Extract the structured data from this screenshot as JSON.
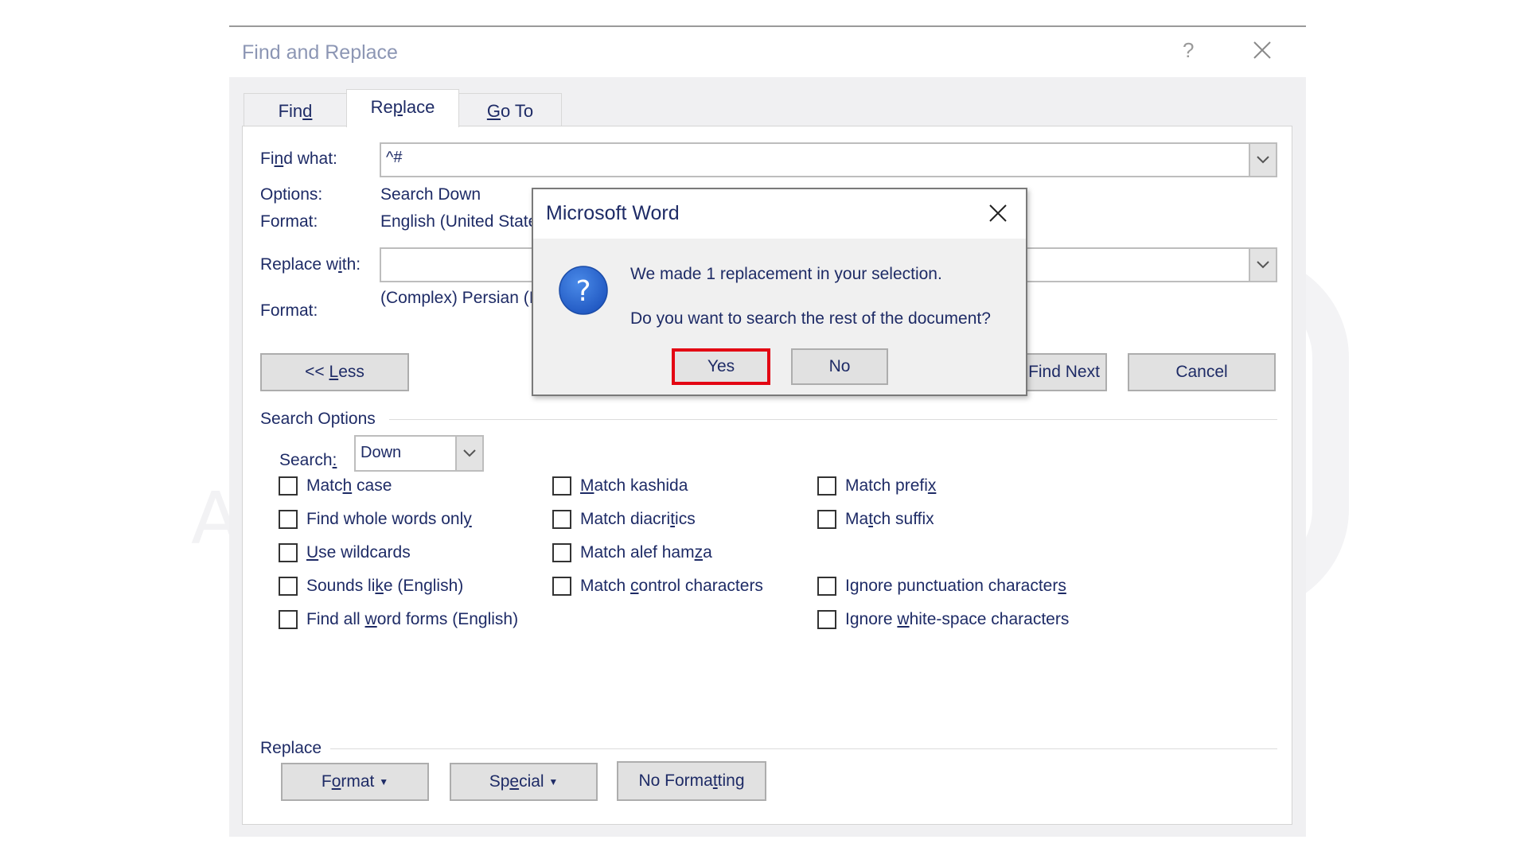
{
  "dialog": {
    "title": "Find and Replace",
    "help_label": "?",
    "close_icon": "close-icon",
    "tabs": [
      {
        "label": "Find",
        "accel": "d",
        "active": false
      },
      {
        "label": "Replace",
        "accel": "p",
        "active": true
      },
      {
        "label": "Go To",
        "accel": "G",
        "active": false
      }
    ],
    "find_what": {
      "label": "Find what:",
      "value": "^#"
    },
    "options": {
      "label": "Options:",
      "value": "Search Down"
    },
    "find_format": {
      "label": "Format:",
      "value": "English (United States)"
    },
    "replace_with": {
      "label": "Replace with:",
      "value": ""
    },
    "replace_format": {
      "label": "Format:",
      "value": "(Complex) Persian (Iran)"
    },
    "buttons": {
      "less": "<< Less",
      "find_next": "Find Next",
      "cancel": "Cancel"
    },
    "search_options": {
      "heading": "Search Options",
      "search_label": "Search:",
      "search_value": "Down",
      "checkboxes": [
        {
          "label": "Match case",
          "checked": false
        },
        {
          "label": "Find whole words only",
          "checked": false
        },
        {
          "label": "Use wildcards",
          "checked": false
        },
        {
          "label": "Sounds like (English)",
          "checked": false
        },
        {
          "label": "Find all word forms (English)",
          "checked": false
        },
        {
          "label": "Match kashida",
          "checked": false
        },
        {
          "label": "Match diacritics",
          "checked": false
        },
        {
          "label": "Match alef hamza",
          "checked": false
        },
        {
          "label": "Match control characters",
          "checked": false
        },
        {
          "label": "Match prefix",
          "checked": false
        },
        {
          "label": "Match suffix",
          "checked": false
        },
        {
          "label": "Ignore punctuation characters",
          "checked": false
        },
        {
          "label": "Ignore white-space characters",
          "checked": false
        }
      ]
    },
    "replace_section": {
      "heading": "Replace",
      "format_button": "Format",
      "special_button": "Special",
      "no_formatting_button": "No Formatting"
    }
  },
  "message_box": {
    "title": "Microsoft Word",
    "icon": "question-icon",
    "line1": "We made 1 replacement in your selection.",
    "line2": "Do you want to search the rest of the document?",
    "yes_label": "Yes",
    "no_label": "No",
    "highlight_color": "#e30613"
  },
  "watermark": {
    "brand": "AZARSYS"
  }
}
